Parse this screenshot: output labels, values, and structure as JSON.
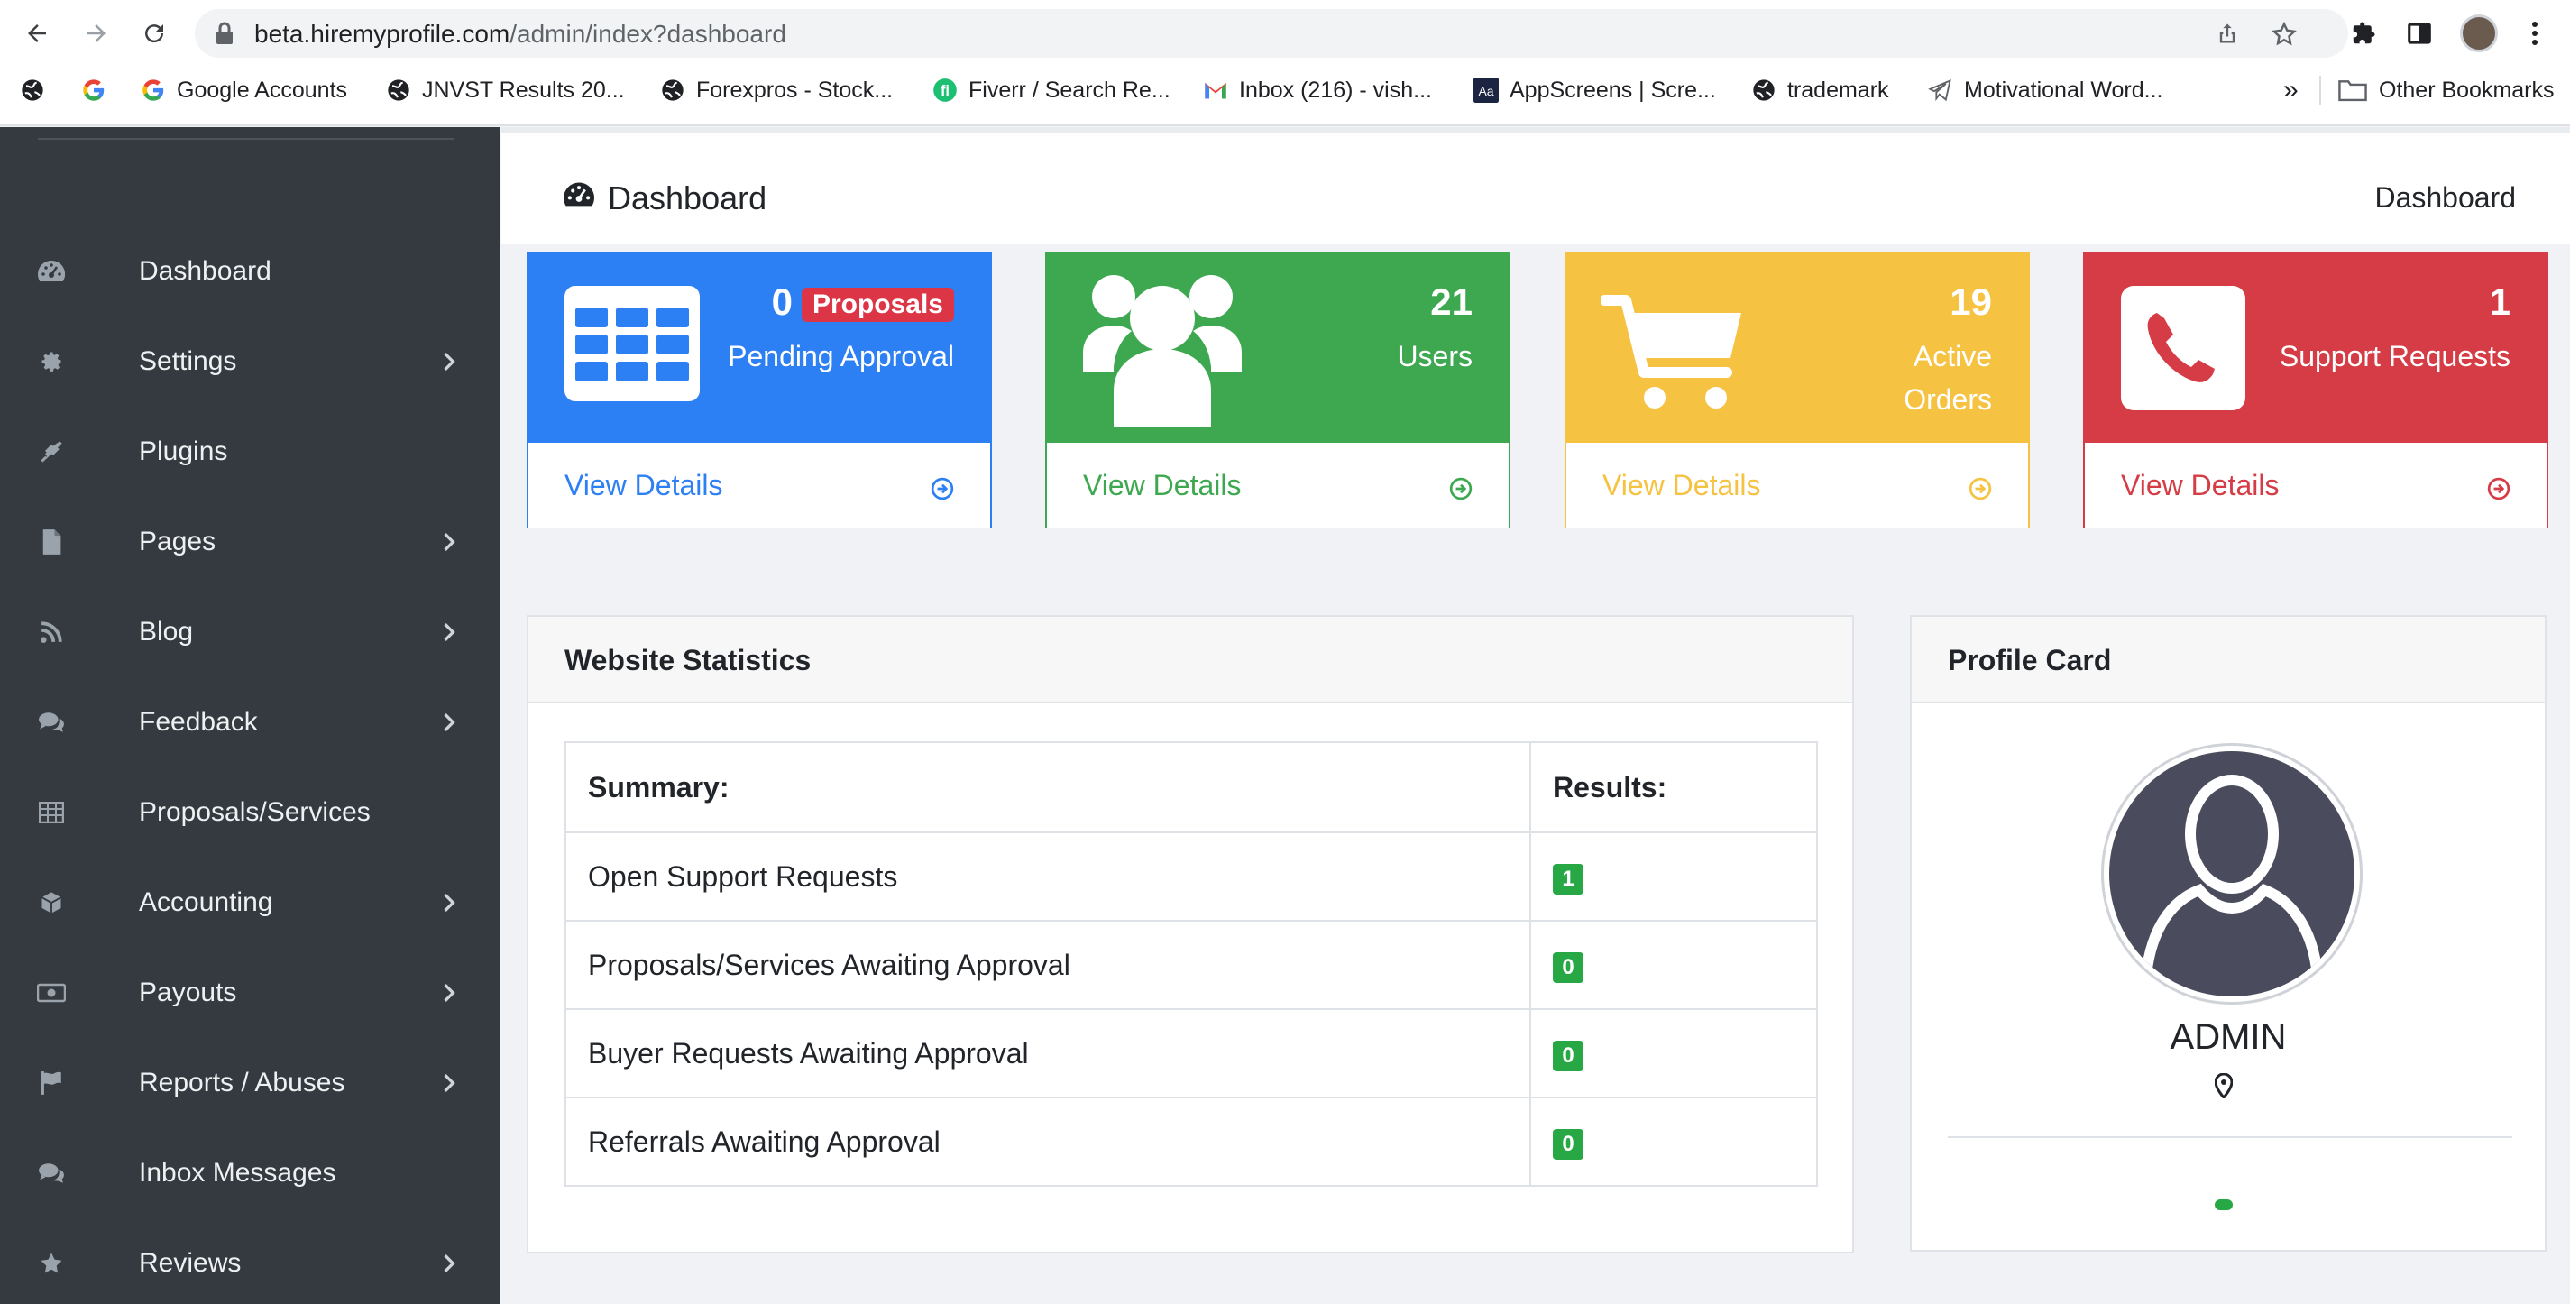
{
  "browser": {
    "url_host": "beta.hiremyprofile.com",
    "url_path": "/admin/index?dashboard",
    "bookmarks": [
      {
        "label": "",
        "icon": "globe-icon"
      },
      {
        "label": "",
        "icon": "google-icon"
      },
      {
        "label": "Google Accounts",
        "icon": "google-icon"
      },
      {
        "label": "JNVST Results 20...",
        "icon": "globe-icon"
      },
      {
        "label": "Forexpros - Stock...",
        "icon": "globe-icon"
      },
      {
        "label": "Fiverr / Search Re...",
        "icon": "fiverr-icon"
      },
      {
        "label": "Inbox (216) - vish...",
        "icon": "gmail-icon"
      },
      {
        "label": "AppScreens | Scre...",
        "icon": "appscreens-icon"
      },
      {
        "label": "trademark",
        "icon": "globe-icon"
      },
      {
        "label": "Motivational Word...",
        "icon": "telegram-icon"
      }
    ],
    "more_bookmarks": "»",
    "other_bookmarks": "Other Bookmarks"
  },
  "sidebar": {
    "items": [
      {
        "label": "Dashboard",
        "icon": "tachometer-icon",
        "has_children": false
      },
      {
        "label": "Settings",
        "icon": "gear-icon",
        "has_children": true
      },
      {
        "label": "Plugins",
        "icon": "plug-icon",
        "has_children": false
      },
      {
        "label": "Pages",
        "icon": "file-icon",
        "has_children": true
      },
      {
        "label": "Blog",
        "icon": "rss-icon",
        "has_children": true
      },
      {
        "label": "Feedback",
        "icon": "comments-icon",
        "has_children": true
      },
      {
        "label": "Proposals/Services",
        "icon": "table-icon",
        "has_children": false
      },
      {
        "label": "Accounting",
        "icon": "cube-icon",
        "has_children": true
      },
      {
        "label": "Payouts",
        "icon": "money-icon",
        "has_children": true
      },
      {
        "label": "Reports / Abuses",
        "icon": "flag-icon",
        "has_children": true
      },
      {
        "label": "Inbox Messages",
        "icon": "comments-icon",
        "has_children": false
      },
      {
        "label": "Reviews",
        "icon": "star-icon",
        "has_children": true
      }
    ]
  },
  "header": {
    "title": "Dashboard",
    "breadcrumb": "Dashboard"
  },
  "stat_boxes": [
    {
      "value": "0",
      "badge": "Proposals",
      "subtitle": "Pending Approval",
      "link": "View Details",
      "color": "#2d7ff4",
      "icon": "table-grid-icon"
    },
    {
      "value": "21",
      "badge": "",
      "subtitle": "Users",
      "link": "View Details",
      "color": "#3ea851",
      "icon": "users-icon"
    },
    {
      "value": "19",
      "badge": "",
      "subtitle": "Active Orders",
      "link": "View Details",
      "color": "#f6c242",
      "icon": "shopping-cart-icon"
    },
    {
      "value": "1",
      "badge": "",
      "subtitle": "Support Requests",
      "link": "View Details",
      "color": "#d53c45",
      "icon": "phone-square-icon"
    }
  ],
  "website_statistics": {
    "title": "Website Statistics",
    "columns": [
      "Summary:",
      "Results:"
    ],
    "rows": [
      {
        "label": "Open Support Requests",
        "value": "1"
      },
      {
        "label": "Proposals/Services Awaiting Approval",
        "value": "0"
      },
      {
        "label": "Buyer Requests Awaiting Approval",
        "value": "0"
      },
      {
        "label": "Referrals Awaiting Approval",
        "value": "0"
      }
    ]
  },
  "profile_card": {
    "title": "Profile Card",
    "name": "ADMIN"
  },
  "colors": {
    "sidebar_bg": "#343a40",
    "badge_green": "#28a745",
    "badge_red": "#dc3545"
  }
}
